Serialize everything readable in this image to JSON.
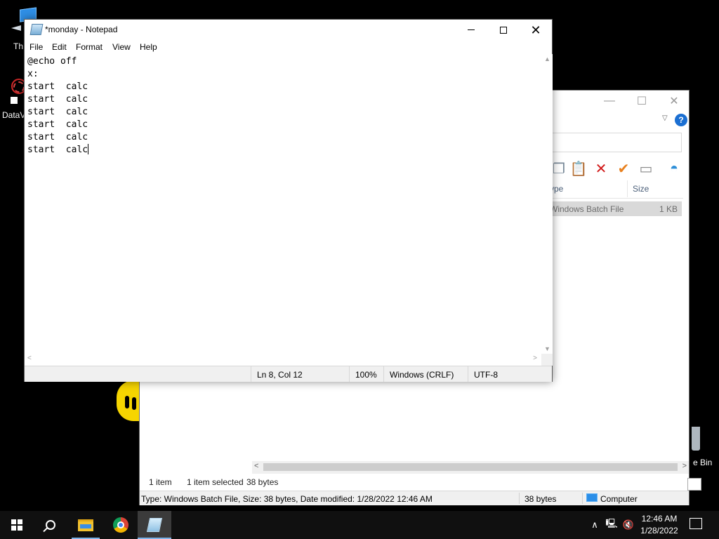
{
  "desktop": {
    "icons": [
      {
        "label": "Th"
      },
      {
        "label": "DataV"
      },
      {
        "label": "e Bin"
      }
    ]
  },
  "explorer": {
    "controls": {
      "minimize": "—",
      "maximize": "☐",
      "close": "✕"
    },
    "help": "?",
    "columns": {
      "type": "ype",
      "size": "Size"
    },
    "row": {
      "type": "Windows Batch File",
      "size": "1 KB"
    },
    "status": {
      "items": "1 item",
      "selected": "1 item selected",
      "bytes": "38 bytes"
    },
    "details": {
      "info": "Type: Windows Batch File, Size: 38 bytes, Date modified: 1/28/2022 12:46 AM",
      "size": "38 bytes",
      "location": "Computer"
    }
  },
  "notepad": {
    "title": "*monday - Notepad",
    "menu": [
      "File",
      "Edit",
      "Format",
      "View",
      "Help"
    ],
    "content_lines": [
      "@echo off",
      "x:",
      "start  calc",
      "start  calc",
      "start  calc",
      "start  calc",
      "start  calc",
      "start  calc"
    ],
    "status": {
      "position": "Ln 8, Col 12",
      "zoom": "100%",
      "line_ending": "Windows (CRLF)",
      "encoding": "UTF-8"
    }
  },
  "taskbar": {
    "apps": [
      "start-button",
      "search-icon",
      "file-explorer-icon",
      "chrome-icon",
      "notepad-icon"
    ],
    "clock": {
      "time": "12:46 AM",
      "date": "1/28/2022"
    },
    "tray_chevron": "∧"
  }
}
